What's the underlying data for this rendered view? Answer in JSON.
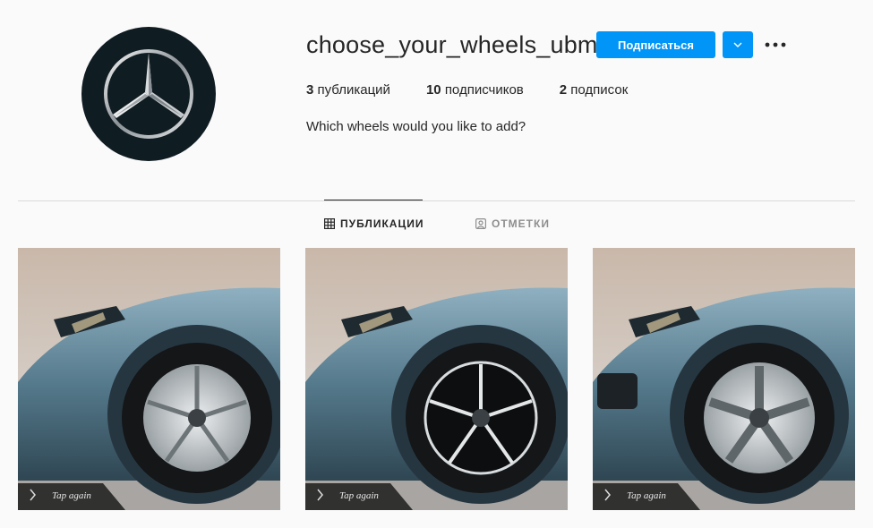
{
  "profile": {
    "username": "choose_your_wheels_ubm",
    "avatar_icon": "mercedes-star-logo",
    "bio": "Which wheels would you like to add?"
  },
  "actions": {
    "follow_label": "Подписаться",
    "dropdown_icon": "chevron-down-icon",
    "more_icon": "more-dots-icon",
    "accent_color": "#0095f6"
  },
  "stats": [
    {
      "count": "3",
      "label": "публикаций"
    },
    {
      "count": "10",
      "label": "подписчиков"
    },
    {
      "count": "2",
      "label": "подписок"
    }
  ],
  "tabs": [
    {
      "label": "ПУБЛИКАЦИИ",
      "icon": "grid-icon",
      "active": true
    },
    {
      "label": "ОТМЕТКИ",
      "icon": "tagged-icon",
      "active": false
    }
  ],
  "posts": [
    {
      "overlay": "Tap again",
      "wheel_style": "silver-twin-spoke"
    },
    {
      "overlay": "Tap again",
      "wheel_style": "black-machined-y-spoke"
    },
    {
      "overlay": "Tap again",
      "wheel_style": "amg-five-spoke"
    }
  ]
}
